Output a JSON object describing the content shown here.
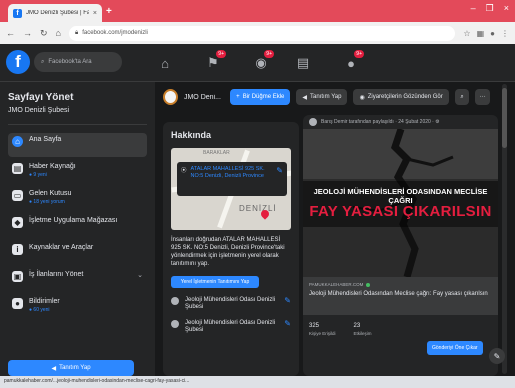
{
  "browser": {
    "tab_title": "JMO Denizli Şubesi | Facebook",
    "tab_close": "×",
    "new_tab": "+",
    "url": "facebook.com/jmodenizli",
    "window_controls": [
      "–",
      "❐",
      "×"
    ]
  },
  "fb": {
    "logo": "f",
    "search_placeholder": "Facebook'ta Ara",
    "badges": {
      "flag": "9+",
      "messages": "9+",
      "notifications": "9+"
    }
  },
  "sidebar": {
    "title": "Sayfayı Yönet",
    "subtitle": "JMO Denizli Şubesi",
    "items": [
      {
        "label": "Ana Sayfa",
        "meta": ""
      },
      {
        "label": "Haber Kaynağı",
        "meta": "● 9 yeni"
      },
      {
        "label": "Gelen Kutusu",
        "meta": "● 18 yeni yorum"
      },
      {
        "label": "İşletme Uygulama Mağazası",
        "meta": ""
      },
      {
        "label": "Kaynaklar ve Araçlar",
        "meta": ""
      },
      {
        "label": "İş İlanlarını Yönet",
        "meta": ""
      },
      {
        "label": "Bildirimler",
        "meta": "● 60 yeni"
      }
    ],
    "promote_label": "Tanıtım Yap"
  },
  "page_bar": {
    "page_name": "JMO Deni...",
    "cta_label": "Bir Düğme Ekle",
    "promote_label": "Tanıtım Yap",
    "viewer_label": "Ziyaretçilerin Gözünden Gör",
    "more": "···"
  },
  "about": {
    "title": "Hakkında",
    "map_label": "BARAKLAR",
    "map_town": "DENİZLİ",
    "location": "ATALAR MAHALLESİ 925 SK. NO:5 Denizli, Denizli Province",
    "description": "İnsanları doğrudan ATALAR MAHALLESİ 925 SK. NO:5 Denizli, Denizli Province'taki yönlendirmek için işletmenin yerel olarak tanıtımını yap.",
    "button": "Yerel İşletmenin Tanıtımını Yap",
    "rows": [
      "Jeoloji Mühendisleri Odası Denizli Şubesi",
      "Jeoloji Mühendisleri Odası Denizli Şubesi"
    ]
  },
  "post": {
    "header": "Barış Demir tarafından paylaşıldı · 24 Şubat 2020 · ⚙",
    "image_line1": "JEOLOJİ MÜHENDİSLERİ ODASINDAN MECLİSE ÇAĞRI",
    "image_line2": "FAY YASASI ÇIKARILSIN",
    "link_domain": "PAMUKKALEHABER.COM",
    "link_title": "Jeoloji Mühendisleri Odasından Meclise çağrı: Fay yasası çıkarılsın",
    "stats": [
      {
        "value": "325",
        "label": "Kişiye Erişildi"
      },
      {
        "value": "23",
        "label": "Etkileşim"
      }
    ],
    "boost_label": "Gönderiyi Öne Çıkar"
  },
  "status_url": "pamukkalehaber.com/...jeoloji-muhendisleri-odasindan-meclise-cagri-fay-yasasi-ci...",
  "colors": {
    "accent": "#2d88ff",
    "chrome_tabs": "#e34a5a",
    "bg": "#18191a",
    "card": "#242526"
  }
}
